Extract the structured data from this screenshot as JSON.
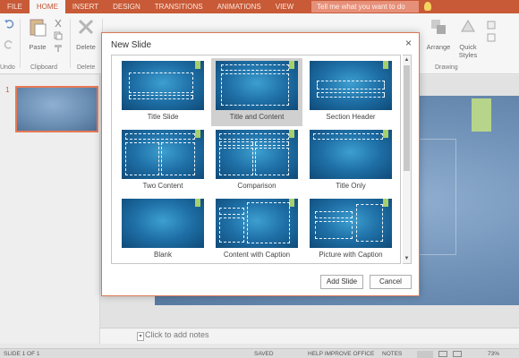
{
  "ribbon": {
    "tabs": [
      "FILE",
      "HOME",
      "INSERT",
      "DESIGN",
      "TRANSITIONS",
      "ANIMATIONS",
      "VIEW"
    ],
    "active_tab": "HOME",
    "tell_me": "Tell me what you want to do",
    "groups": {
      "undo": "Undo",
      "clipboard": "Clipboard",
      "paste": "Paste",
      "delete_btn": "Delete",
      "delete_group": "Delete",
      "arrange": "Arrange",
      "quick_styles": "Quick Styles",
      "drawing": "Drawing"
    },
    "colors": {
      "accent": "#c85a37",
      "ribbon_bg": "#f6f6f6"
    }
  },
  "slides_pane": {
    "slide_number": "1"
  },
  "notes": {
    "placeholder": "Click to add notes"
  },
  "status_bar": {
    "slide_info": "SLIDE 1 OF 1",
    "saved": "SAVED",
    "help": "HELP IMPROVE OFFICE",
    "notes": "NOTES",
    "zoom": "73%"
  },
  "dialog": {
    "title": "New Slide",
    "close": "×",
    "layouts": [
      {
        "label": "Title Slide",
        "selected": false
      },
      {
        "label": "Title and Content",
        "selected": true
      },
      {
        "label": "Section Header",
        "selected": false
      },
      {
        "label": "Two Content",
        "selected": false
      },
      {
        "label": "Comparison",
        "selected": false
      },
      {
        "label": "Title Only",
        "selected": false
      },
      {
        "label": "Blank",
        "selected": false
      },
      {
        "label": "Content with Caption",
        "selected": false
      },
      {
        "label": "Picture with Caption",
        "selected": false
      }
    ],
    "add_button": "Add Slide",
    "cancel_button": "Cancel"
  }
}
